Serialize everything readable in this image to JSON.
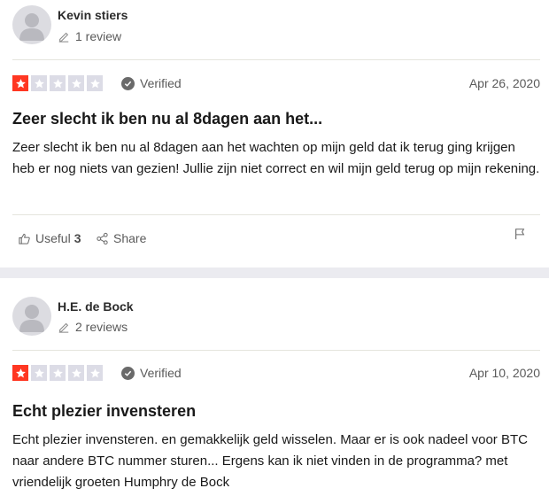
{
  "reviews": [
    {
      "reviewer_name": "Kevin stiers",
      "review_count": "1 review",
      "rating": 1,
      "max_rating": 5,
      "verified_label": "Verified",
      "date": "Apr 26, 2020",
      "title": "Zeer slecht ik ben nu al 8dagen aan het...",
      "body": "Zeer slecht ik ben nu al 8dagen aan het wachten op mijn geld dat ik terug ging krijgen heb er nog niets van gezien! Jullie zijn niet correct en wil mijn geld terug op mijn rekening.",
      "useful_label": "Useful",
      "useful_count": "3",
      "share_label": "Share"
    },
    {
      "reviewer_name": "H.E. de Bock",
      "review_count": "2 reviews",
      "rating": 1,
      "max_rating": 5,
      "verified_label": "Verified",
      "date": "Apr 10, 2020",
      "title": "Echt plezier invensteren",
      "body": "Echt plezier invensteren. en gemakkelijk geld wisselen. Maar er is ook nadeel voor BTC naar andere BTC nummer sturen... Ergens kan ik niet vinden in de programma? met vriendelijk groeten Humphry de Bock"
    }
  ],
  "colors": {
    "star_filled": "#ff3722",
    "star_empty": "#dcdce6",
    "separator": "#ebebf0"
  }
}
